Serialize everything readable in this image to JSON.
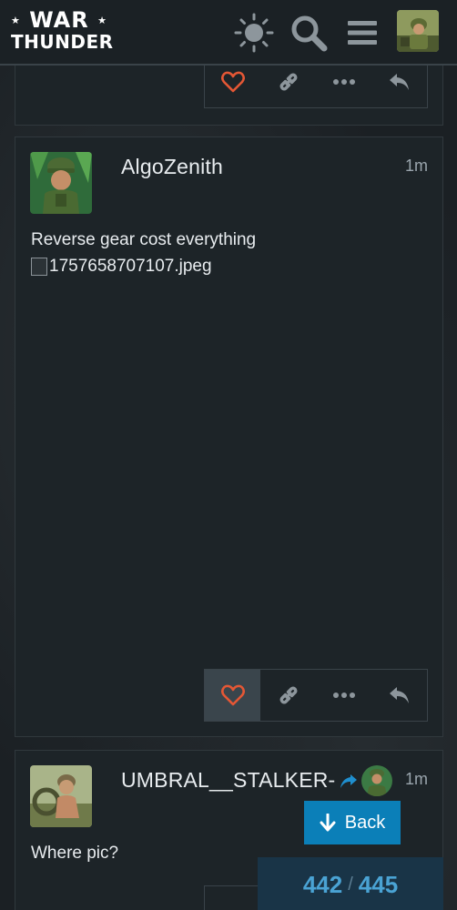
{
  "header": {
    "logo_top": "WAR",
    "logo_bottom": "THUNDER",
    "icons": [
      "theme-toggle-icon",
      "search-icon",
      "menu-icon"
    ],
    "user_avatar": "user-avatar"
  },
  "posts": [
    {
      "id": "previous-post",
      "actions": [
        "like",
        "copy-link",
        "more",
        "reply"
      ]
    },
    {
      "id": "algozenith-post",
      "username": "AlgoZenith",
      "time": "1m",
      "text": "Reverse gear cost everything",
      "image_alt": "1757658707107.jpeg",
      "actions": [
        "like",
        "copy-link",
        "more",
        "reply"
      ],
      "liked_highlight": true
    },
    {
      "id": "umbral-post",
      "username": "UMBRAL__STALKER-",
      "time": "1m",
      "text": "Where pic?"
    }
  ],
  "back_button": {
    "label": "Back"
  },
  "progress": {
    "current": "442",
    "separator": "/",
    "total": "445"
  },
  "colors": {
    "accent": "#0b7fb8",
    "like_red": "#e45735",
    "counter_text": "#4aa3d4",
    "counter_bg": "#193447"
  }
}
